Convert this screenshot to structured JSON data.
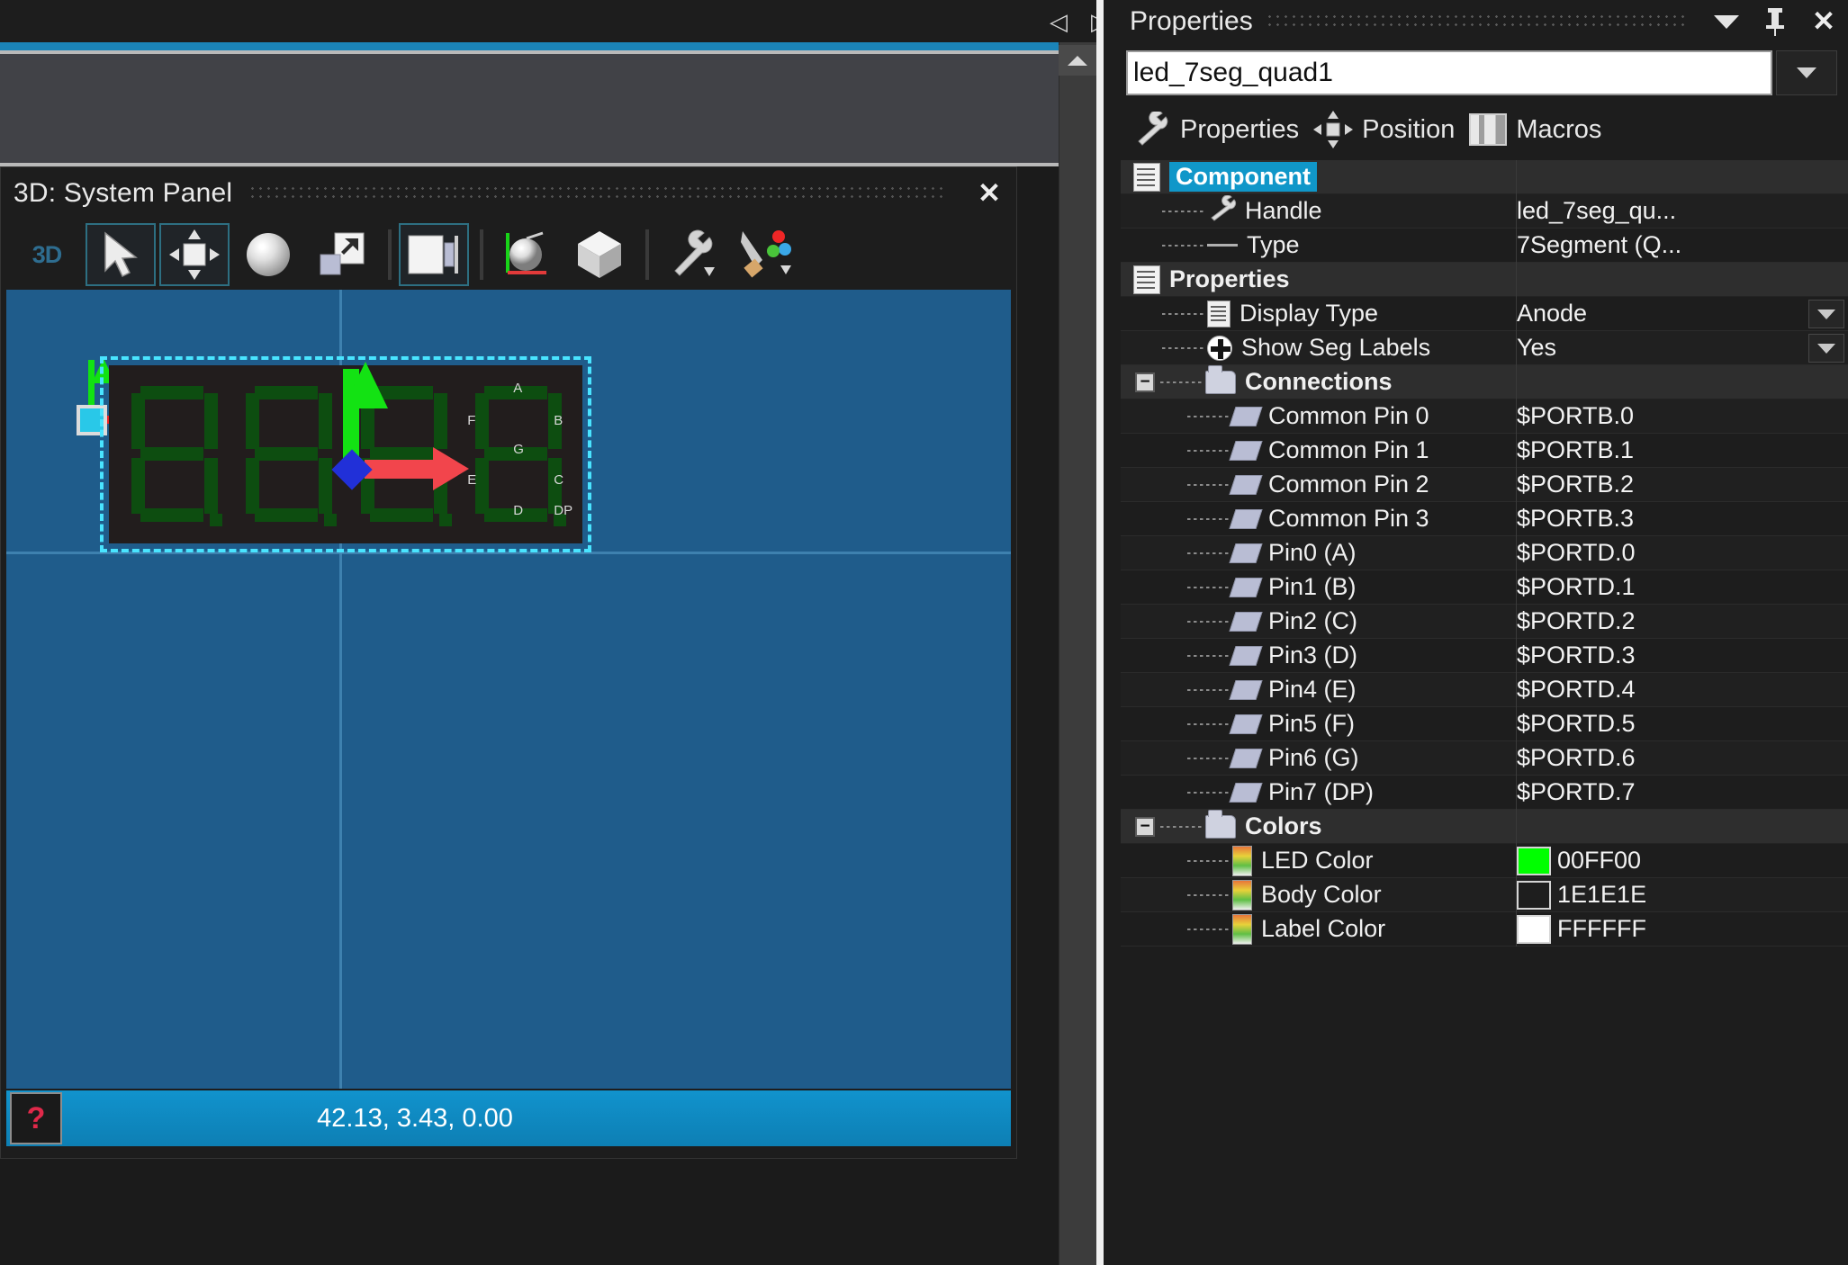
{
  "tab_strip": {
    "prev_arrow": "◁",
    "next_arrow": "▷"
  },
  "panel3d": {
    "title": "3D: System Panel",
    "close_label": "✕",
    "toolbar": {
      "mode_label": "3D",
      "buttons": [
        {
          "name": "select-tool",
          "icon": "arrow-cursor-icon",
          "selected": true
        },
        {
          "name": "move-tool",
          "icon": "move-arrows-icon",
          "selected": true
        },
        {
          "name": "rotate-tool",
          "icon": "sphere-icon",
          "selected": false
        },
        {
          "name": "scale-tool",
          "icon": "scale-icon",
          "selected": false
        },
        {
          "name": "camera-tool",
          "icon": "camera-view-icon",
          "selected": true
        },
        {
          "name": "lighting-tool",
          "icon": "sphere-axes-icon",
          "selected": false
        },
        {
          "name": "shading-tool",
          "icon": "cube-icon",
          "selected": false
        },
        {
          "name": "settings-tool",
          "icon": "wrench-dropdown-icon",
          "selected": false
        },
        {
          "name": "render-tool",
          "icon": "paint-dropdown-icon",
          "selected": false
        }
      ]
    },
    "viewport": {
      "status_coords": "42.13, 3.43, 0.00",
      "help_glyph": "?",
      "component": {
        "digits": 4,
        "segment_labels": [
          "A",
          "F",
          "B",
          "G",
          "E",
          "C",
          "D",
          "DP"
        ]
      }
    }
  },
  "properties_panel": {
    "title": "Properties",
    "title_buttons": [
      "chevron-down",
      "pin",
      "close"
    ],
    "close_label": "✕",
    "pin_label": "⚐",
    "handle_field": {
      "value": "led_7seg_quad1",
      "placeholder": ""
    },
    "tabs": [
      {
        "label": "Properties",
        "icon": "wrench-icon",
        "active": true
      },
      {
        "label": "Position",
        "icon": "move-icon",
        "active": false
      },
      {
        "label": "Macros",
        "icon": "macros-icon",
        "active": false
      }
    ],
    "tree": [
      {
        "kind": "group",
        "label": "Component",
        "value": "",
        "icon": "document-icon",
        "selected": true
      },
      {
        "kind": "item",
        "label": "Handle",
        "value": "led_7seg_qu...",
        "icon": "wrench-small-icon"
      },
      {
        "kind": "item",
        "label": "Type",
        "value": "7Segment (Q...",
        "icon": "line-icon"
      },
      {
        "kind": "group",
        "label": "Properties",
        "value": "",
        "icon": "document-icon"
      },
      {
        "kind": "item",
        "label": "Display Type",
        "value": "Anode",
        "icon": "list-icon",
        "dropdown": true
      },
      {
        "kind": "item",
        "label": "Show Seg Labels",
        "value": "Yes",
        "icon": "plus-circle-icon",
        "dropdown": true
      },
      {
        "kind": "group",
        "label": "Connections",
        "value": "",
        "icon": "folder-icon",
        "expander": "−"
      },
      {
        "kind": "item",
        "label": "Common Pin 0",
        "value": "$PORTB.0",
        "icon": "pin-icon"
      },
      {
        "kind": "item",
        "label": "Common Pin 1",
        "value": "$PORTB.1",
        "icon": "pin-icon"
      },
      {
        "kind": "item",
        "label": "Common Pin 2",
        "value": "$PORTB.2",
        "icon": "pin-icon"
      },
      {
        "kind": "item",
        "label": "Common Pin 3",
        "value": "$PORTB.3",
        "icon": "pin-icon"
      },
      {
        "kind": "item",
        "label": "Pin0 (A)",
        "value": "$PORTD.0",
        "icon": "pin-icon"
      },
      {
        "kind": "item",
        "label": "Pin1 (B)",
        "value": "$PORTD.1",
        "icon": "pin-icon"
      },
      {
        "kind": "item",
        "label": "Pin2 (C)",
        "value": "$PORTD.2",
        "icon": "pin-icon"
      },
      {
        "kind": "item",
        "label": "Pin3 (D)",
        "value": "$PORTD.3",
        "icon": "pin-icon"
      },
      {
        "kind": "item",
        "label": "Pin4 (E)",
        "value": "$PORTD.4",
        "icon": "pin-icon"
      },
      {
        "kind": "item",
        "label": "Pin5 (F)",
        "value": "$PORTD.5",
        "icon": "pin-icon"
      },
      {
        "kind": "item",
        "label": "Pin6 (G)",
        "value": "$PORTD.6",
        "icon": "pin-icon"
      },
      {
        "kind": "item",
        "label": "Pin7 (DP)",
        "value": "$PORTD.7",
        "icon": "pin-icon"
      },
      {
        "kind": "group",
        "label": "Colors",
        "value": "",
        "icon": "folder-icon",
        "expander": "−"
      },
      {
        "kind": "color",
        "label": "LED Color",
        "value": "00FF00",
        "swatch": "#00FF00",
        "icon": "gradient-icon"
      },
      {
        "kind": "color",
        "label": "Body Color",
        "value": "1E1E1E",
        "swatch": "#1E1E1E",
        "icon": "gradient-icon"
      },
      {
        "kind": "color",
        "label": "Label Color",
        "value": "FFFFFF",
        "swatch": "#FFFFFF",
        "icon": "gradient-icon"
      }
    ]
  },
  "colors": {
    "accent_blue": "#1b84b8",
    "viewport_blue": "#1f5c8b",
    "selection_cyan": "#49e4ff",
    "led_green": "#00FF00",
    "body_dark": "#1E1E1E",
    "label_white": "#FFFFFF",
    "status_blue": "#0d7fb4",
    "tree_selected": "#1097c9"
  }
}
